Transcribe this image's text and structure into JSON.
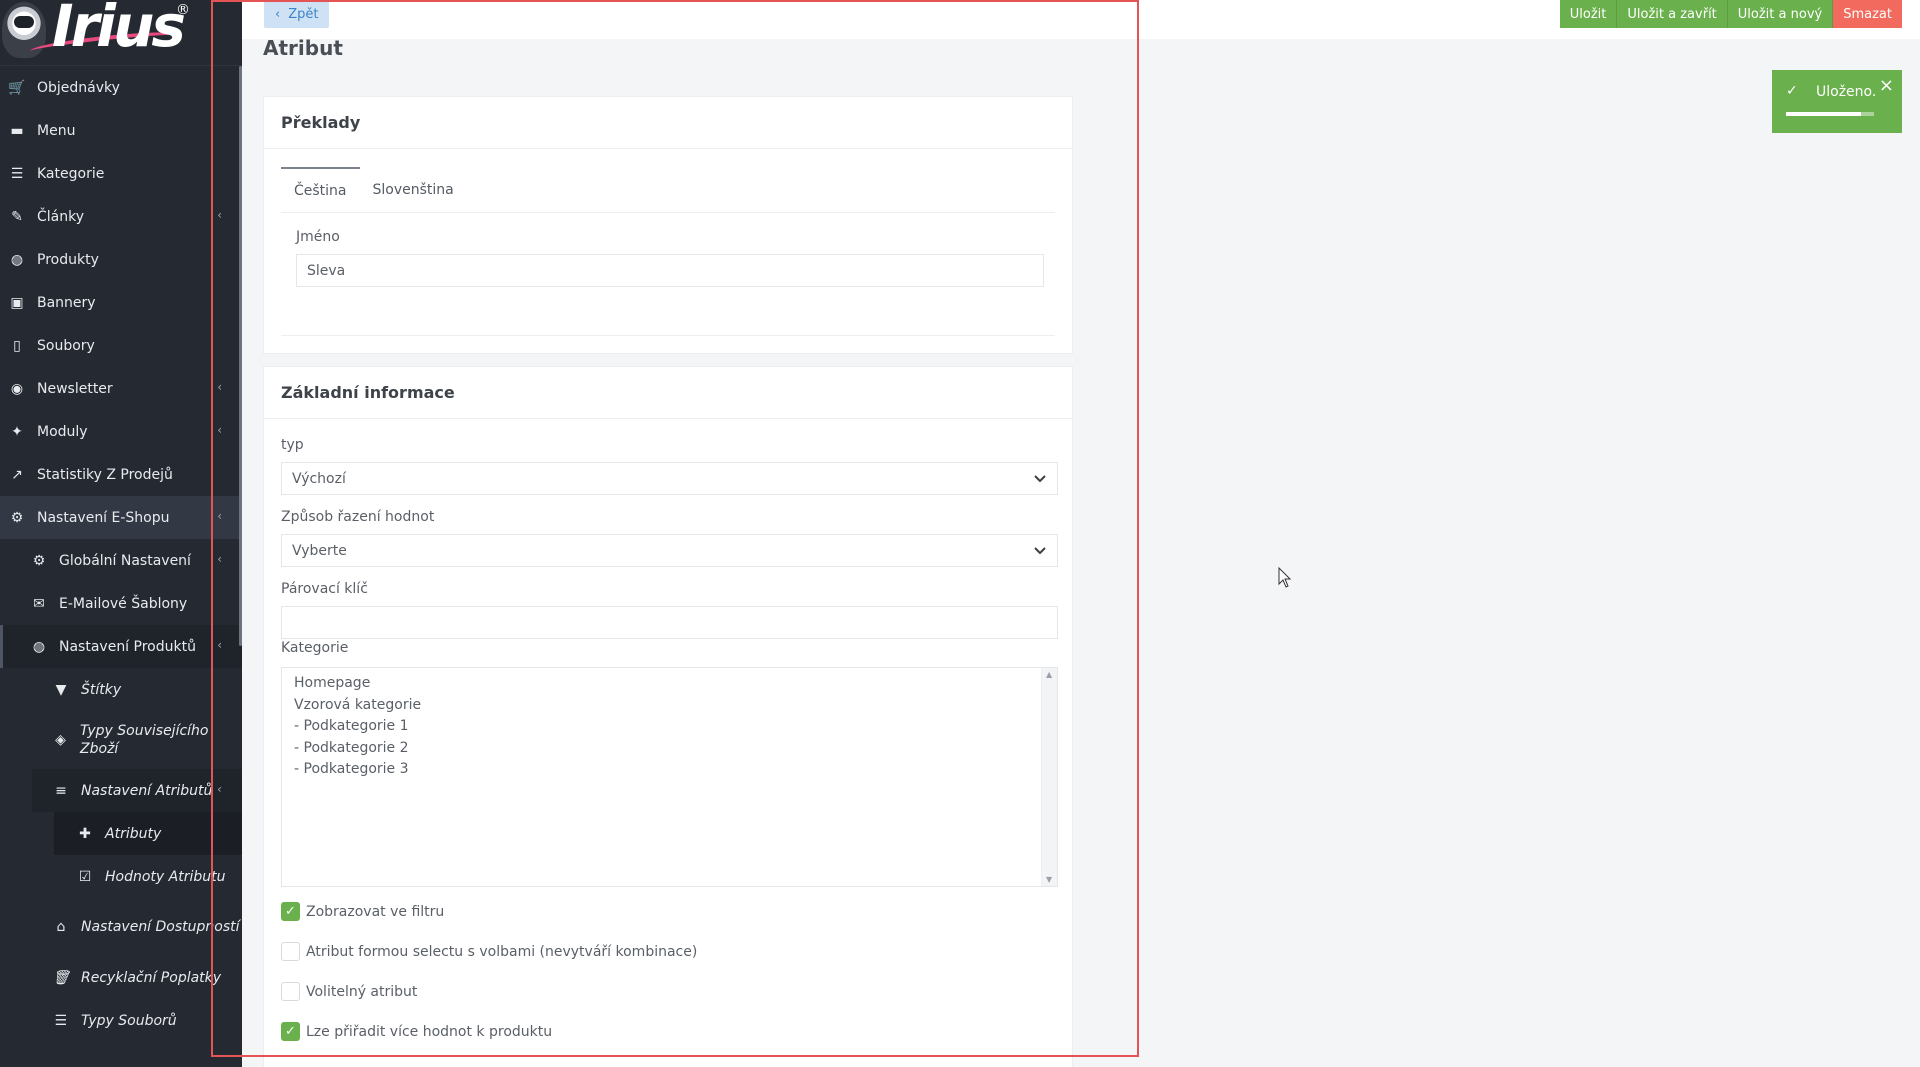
{
  "logo": {
    "text": "Irius",
    "reg": "®"
  },
  "sidebar": {
    "items": [
      {
        "label": "Objednávky",
        "icon": "cart-icon"
      },
      {
        "label": "Menu",
        "icon": "folder-icon"
      },
      {
        "label": "Kategorie",
        "icon": "list-icon"
      },
      {
        "label": "Články",
        "icon": "pencil-icon",
        "has_children": true
      },
      {
        "label": "Produkty",
        "icon": "basketball-icon"
      },
      {
        "label": "Bannery",
        "icon": "image-icon"
      },
      {
        "label": "Soubory",
        "icon": "file-icon"
      },
      {
        "label": "Newsletter",
        "icon": "envelope-circle-icon",
        "has_children": true
      },
      {
        "label": "Moduly",
        "icon": "puzzle-icon",
        "has_children": true
      },
      {
        "label": "Statistiky Z Prodejů",
        "icon": "chart-line-icon"
      },
      {
        "label": "Nastavení E-Shopu",
        "icon": "cogs-icon",
        "has_children": true,
        "active": true
      },
      {
        "label": "Globální Nastavení",
        "icon": "gear-icon",
        "has_children": true
      },
      {
        "label": "E-Mailové Šablony",
        "icon": "envelope-icon"
      },
      {
        "label": "Nastavení Produktů",
        "icon": "basketball-icon",
        "has_children": true,
        "active": true
      },
      {
        "label": "Štítky",
        "icon": "bookmark-icon"
      },
      {
        "label": "Typy Souvisejícího Zboží",
        "icon": "layers-icon"
      },
      {
        "label": "Nastavení Atributů",
        "icon": "sliders-icon",
        "has_children": true,
        "active": true
      },
      {
        "label": "Atributy",
        "icon": "plus-icon",
        "active": true
      },
      {
        "label": "Hodnoty Atributu",
        "icon": "checkbox-icon"
      },
      {
        "label": "Nastavení Dostupností",
        "icon": "home-icon"
      },
      {
        "label": "Recyklační Poplatky",
        "icon": "trash-icon"
      },
      {
        "label": "Typy Souborů",
        "icon": "list-icon"
      }
    ]
  },
  "topbar": {
    "back_label": "Zpět",
    "actions": [
      "Uložit",
      "Uložit a zavřít",
      "Uložit a nový",
      "Smazat"
    ]
  },
  "page": {
    "title": "Atribut"
  },
  "translations": {
    "header": "Překlady",
    "tabs": [
      "Čeština",
      "Slovenština"
    ],
    "active_tab": "Čeština",
    "name_label": "Jméno",
    "name_value": "Sleva"
  },
  "basic_info": {
    "header": "Základní informace",
    "type_label": "typ",
    "type_value": "Výchozí",
    "sort_label": "Způsob řazení hodnot",
    "sort_value": "Vyberte",
    "pair_key_label": "Párovací klíč",
    "pair_key_value": "",
    "category_label": "Kategorie",
    "categories": [
      "Homepage",
      "Vzorová kategorie",
      "- Podkategorie 1",
      "- Podkategorie 2",
      "- Podkategorie 3"
    ],
    "checkboxes": [
      {
        "label": "Zobrazovat ve filtru",
        "checked": true
      },
      {
        "label": "Atribut formou selectu s volbami (nevytváří kombinace)",
        "checked": false
      },
      {
        "label": "Volitelný atribut",
        "checked": false
      },
      {
        "label": "Lze přiřadit více hodnot k produktu",
        "checked": true
      }
    ]
  },
  "toast": {
    "message": "Uloženo.",
    "progress": 0.85
  },
  "colors": {
    "accent": "#6ab04c",
    "danger": "#f26a5d",
    "sidebar": "#252a32",
    "selection": "#e45454"
  }
}
